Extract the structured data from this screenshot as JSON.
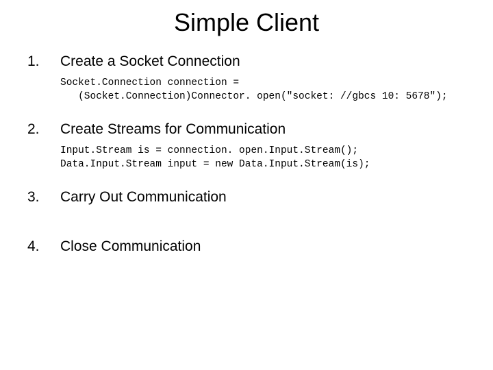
{
  "title": "Simple Client",
  "items": [
    {
      "number": "1.",
      "heading": "Create a Socket Connection",
      "code": "Socket.Connection connection =\n   (Socket.Connection)Connector. open(\"socket: //gbcs 10: 5678\");"
    },
    {
      "number": "2.",
      "heading": "Create Streams for Communication",
      "code": "Input.Stream is = connection. open.Input.Stream();\nData.Input.Stream input = new Data.Input.Stream(is);"
    },
    {
      "number": "3.",
      "heading": "Carry Out Communication"
    },
    {
      "number": "4.",
      "heading": "Close Communication"
    }
  ]
}
